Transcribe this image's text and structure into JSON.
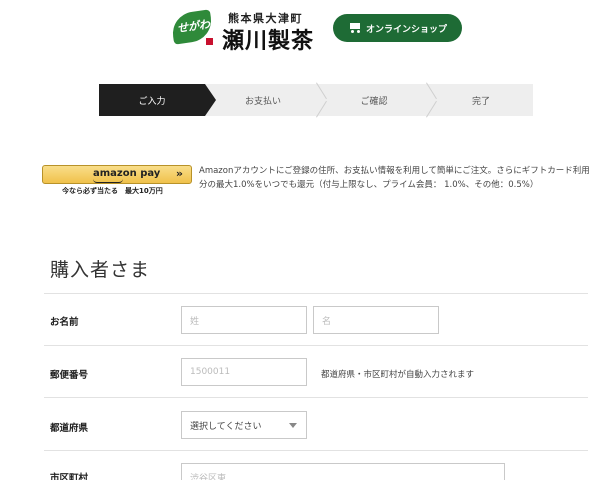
{
  "header": {
    "logo_badge_text": "せがわ",
    "logo_subtitle": "熊本県大津町",
    "logo_title": "瀬川製茶",
    "shop_button_label": "オンラインショップ"
  },
  "steps": [
    {
      "label": "ご入力"
    },
    {
      "label": "お支払い"
    },
    {
      "label": "ご確認"
    },
    {
      "label": "完了"
    }
  ],
  "amazon_pay": {
    "button_label": "amazon pay",
    "button_arrow": "»",
    "caption": "今なら必ず当たる　最大10万円",
    "description": "Amazonアカウントにご登録の住所、お支払い情報を利用して簡単にご注文。さらにギフトカード利用分の最大1.0%をいつでも還元（付与上限なし、プライム会員： 1.0%、その他：0.5%）"
  },
  "form": {
    "section_title": "購入者さま",
    "name_label": "お名前",
    "last_name_placeholder": "姓",
    "first_name_placeholder": "名",
    "postal_label": "郵便番号",
    "postal_placeholder": "1500011",
    "postal_hint": "都道府県・市区町村が自動入力されます",
    "prefecture_label": "都道府県",
    "prefecture_value": "選択してください",
    "city_label": "市区町村",
    "city_placeholder": "渋谷区東"
  },
  "colors": {
    "brand_green": "#1e6b35",
    "logo_green": "#2f8a3a",
    "step_active": "#1f1f1f",
    "amazon_yellow": "#f0c14b"
  }
}
